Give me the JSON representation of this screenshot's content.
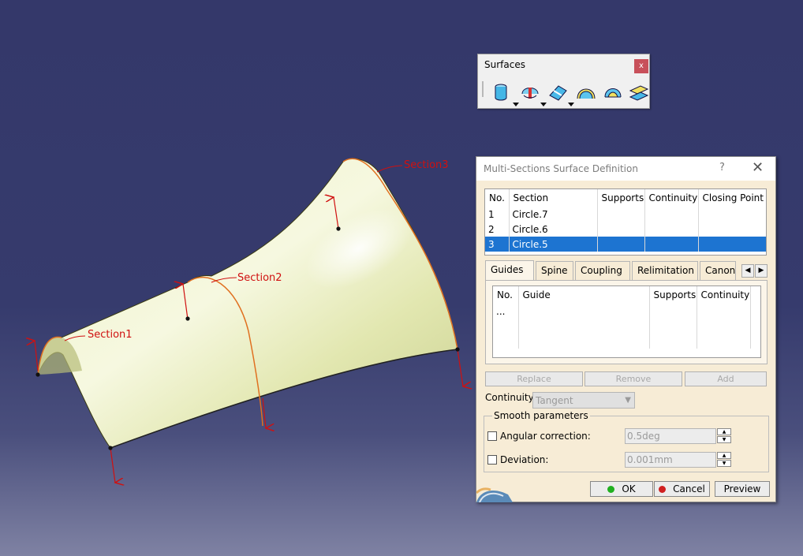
{
  "viewport": {
    "section_labels": [
      "Section1",
      "Section2",
      "Section3"
    ]
  },
  "toolbar": {
    "title": "Surfaces",
    "close_label": "x",
    "icons": [
      "extrude-surface-icon",
      "revolve-surface-icon",
      "sphere-surface-icon",
      "offset-surface-icon",
      "sweep-surface-icon",
      "multi-sections-surface-icon"
    ]
  },
  "dialog": {
    "title": "Multi-Sections Surface Definition",
    "help_label": "?",
    "close_label": "✕",
    "sections_table": {
      "headers": [
        "No.",
        "Section",
        "Supports",
        "Continuity",
        "Closing Point"
      ],
      "rows": [
        {
          "no": "1",
          "section": "Circle.7",
          "supports": "",
          "continuity": "",
          "closing": ""
        },
        {
          "no": "2",
          "section": "Circle.6",
          "supports": "",
          "continuity": "",
          "closing": ""
        },
        {
          "no": "3",
          "section": "Circle.5",
          "supports": "",
          "continuity": "",
          "closing": ""
        }
      ],
      "selected_row": 2
    },
    "tabs": [
      "Guides",
      "Spine",
      "Coupling",
      "Relimitation",
      "Canonic"
    ],
    "active_tab": "Guides",
    "guides_table": {
      "headers": [
        "No.",
        "Guide",
        "Supports",
        "Continuity"
      ],
      "rows": [
        {
          "no": "...",
          "guide": "",
          "supports": "",
          "continuity": ""
        }
      ]
    },
    "buttons_row": {
      "replace": "Replace",
      "remove": "Remove",
      "add": "Add"
    },
    "continuity": {
      "label": "Continuity:",
      "value": "Tangent"
    },
    "smooth": {
      "legend": "Smooth parameters",
      "angular_label": "Angular correction:",
      "angular_value": "0.5deg",
      "deviation_label": "Deviation:",
      "deviation_value": "0.001mm"
    },
    "footer": {
      "ok": "OK",
      "cancel": "Cancel",
      "preview": "Preview"
    }
  },
  "colors": {
    "background_top": "#34386a",
    "surface": "#e9eec0",
    "section_curve": "#e07020",
    "annotation": "#d01010",
    "selection": "#1d74d1",
    "dialog_bg": "#f7ecd6"
  }
}
